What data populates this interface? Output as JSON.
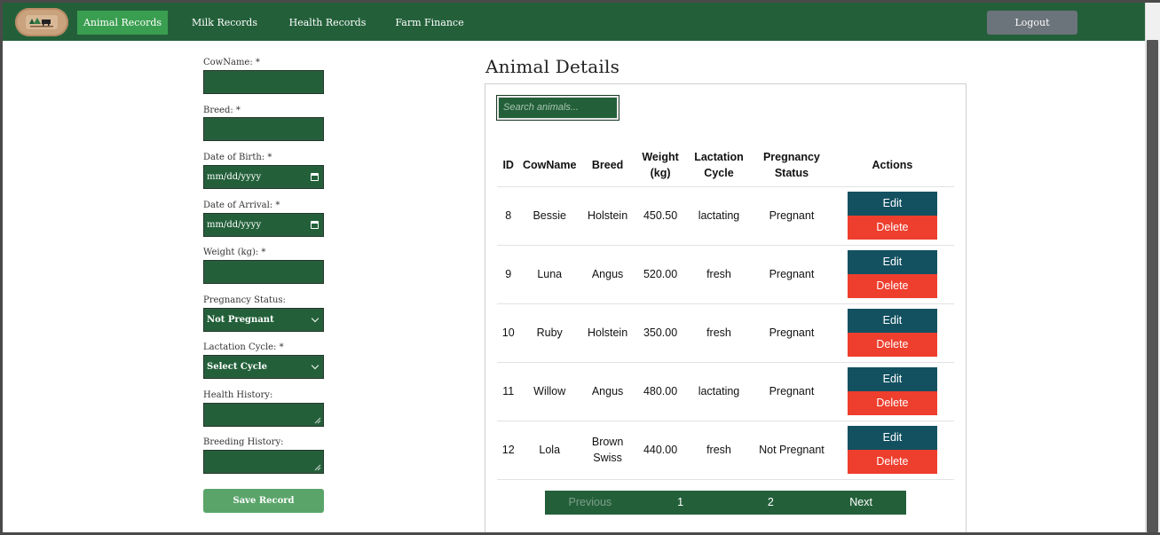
{
  "nav": {
    "items": [
      {
        "label": "Animal Records",
        "active": true
      },
      {
        "label": "Milk Records",
        "active": false
      },
      {
        "label": "Health Records",
        "active": false
      },
      {
        "label": "Farm Finance",
        "active": false
      }
    ],
    "logout_label": "Logout",
    "logo_icon": "farm-logo-icon"
  },
  "form": {
    "fields": [
      {
        "label": "CowName: *",
        "type": "text",
        "value": ""
      },
      {
        "label": "Breed: *",
        "type": "text",
        "value": ""
      },
      {
        "label": "Date of Birth: *",
        "type": "date",
        "value": "mm/dd/yyyy"
      },
      {
        "label": "Date of Arrival: *",
        "type": "date",
        "value": "mm/dd/yyyy"
      },
      {
        "label": "Weight (kg): *",
        "type": "text",
        "value": ""
      },
      {
        "label": "Pregnancy Status:",
        "type": "select",
        "value": "Not Pregnant"
      },
      {
        "label": "Lactation Cycle: *",
        "type": "select",
        "value": "Select Cycle"
      },
      {
        "label": "Health History:",
        "type": "textarea",
        "value": ""
      },
      {
        "label": "Breeding History:",
        "type": "textarea",
        "value": ""
      }
    ],
    "save_label": "Save Record"
  },
  "details": {
    "title": "Animal Details",
    "search_placeholder": "Search animals...",
    "columns": [
      "ID",
      "CowName",
      "Breed",
      "Weight (kg)",
      "Lactation Cycle",
      "Pregnancy Status",
      "Actions"
    ],
    "rows": [
      {
        "id": "8",
        "name": "Bessie",
        "breed": "Holstein",
        "weight": "450.50",
        "lactation": "lactating",
        "pregnancy": "Pregnant"
      },
      {
        "id": "9",
        "name": "Luna",
        "breed": "Angus",
        "weight": "520.00",
        "lactation": "fresh",
        "pregnancy": "Pregnant"
      },
      {
        "id": "10",
        "name": "Ruby",
        "breed": "Holstein",
        "weight": "350.00",
        "lactation": "fresh",
        "pregnancy": "Pregnant"
      },
      {
        "id": "11",
        "name": "Willow",
        "breed": "Angus",
        "weight": "480.00",
        "lactation": "lactating",
        "pregnancy": "Pregnant"
      },
      {
        "id": "12",
        "name": "Lola",
        "breed": "Brown Swiss",
        "weight": "440.00",
        "lactation": "fresh",
        "pregnancy": "Not Pregnant"
      }
    ],
    "edit_label": "Edit",
    "delete_label": "Delete"
  },
  "pager": {
    "previous": "Previous",
    "pages": [
      "1",
      "2"
    ],
    "next": "Next"
  },
  "colors": {
    "primary_green": "#23603a",
    "active_green": "#3a9e50",
    "edit_teal": "#135161",
    "delete_red": "#ee3e2d",
    "logout_gray": "#6b737b"
  }
}
